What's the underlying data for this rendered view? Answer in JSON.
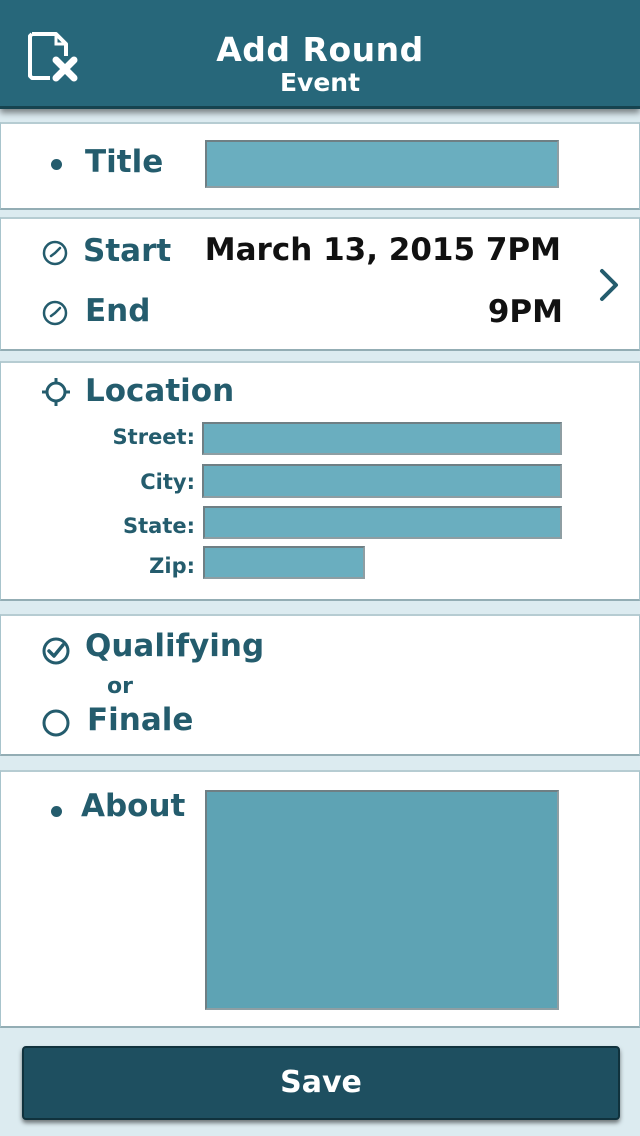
{
  "header": {
    "title": "Add Round",
    "subtitle": "Event",
    "close_icon": "document-close-icon"
  },
  "title_section": {
    "label": "Title",
    "value": ""
  },
  "time_section": {
    "start_label": "Start",
    "start_value": "March 13, 2015 7PM",
    "end_label": "End",
    "end_value": "9PM",
    "clock_icon": "clock-icon",
    "chevron_icon": "chevron-right-icon"
  },
  "location_section": {
    "label": "Location",
    "icon": "crosshair-icon",
    "street_label": "Street:",
    "city_label": "City:",
    "state_label": "State:",
    "zip_label": "Zip:",
    "street_value": "",
    "city_value": "",
    "state_value": "",
    "zip_value": ""
  },
  "round_type": {
    "option_qualifying": "Qualifying",
    "or_text": "or",
    "option_finale": "Finale",
    "selected": "Qualifying"
  },
  "about_section": {
    "label": "About",
    "value": ""
  },
  "save_button": {
    "label": "Save"
  },
  "colors": {
    "header_bg": "#27677a",
    "accent_text": "#245c6d",
    "field_bg": "#6aaebf",
    "save_bg": "#1e4f60"
  }
}
